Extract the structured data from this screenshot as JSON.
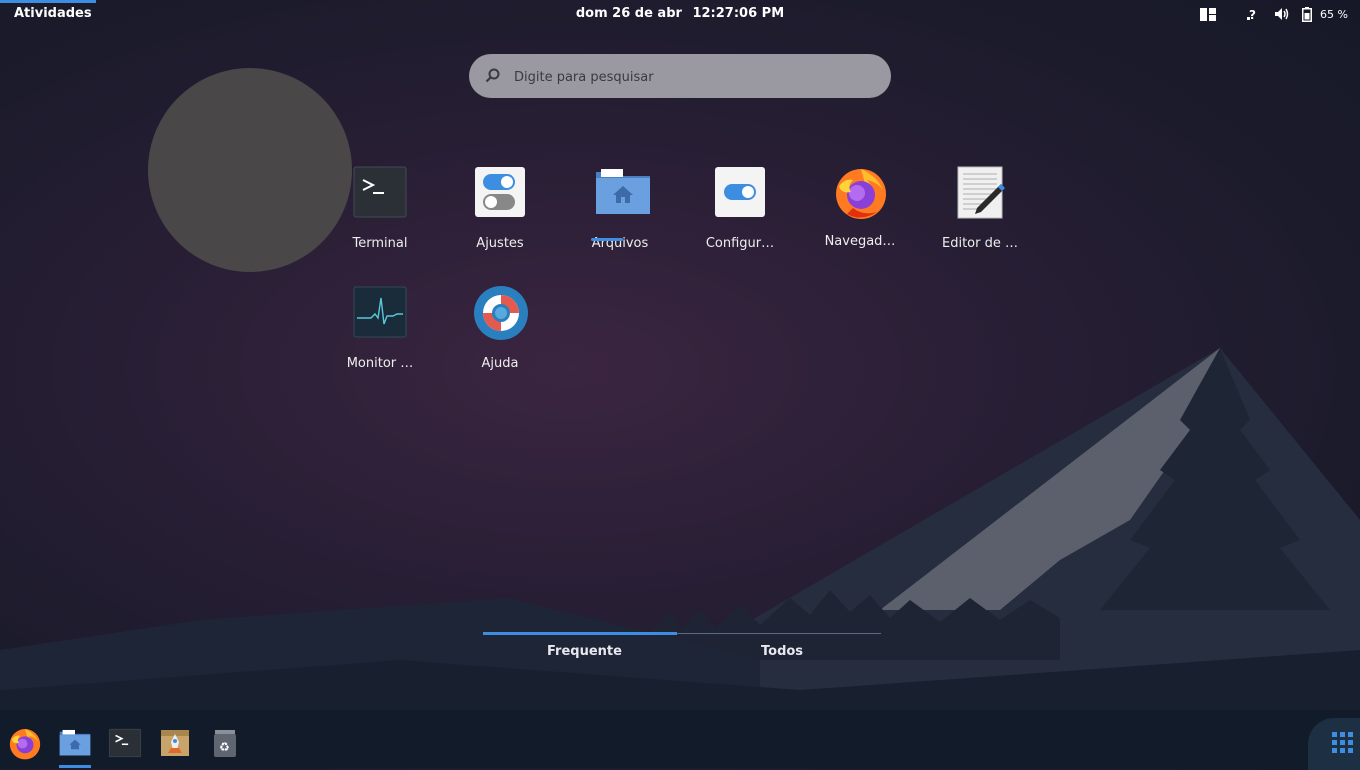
{
  "topbar": {
    "activities": "Atividades",
    "date": "dom 26 de abr",
    "time": "12:27:06 PM",
    "battery_percent": "65 %"
  },
  "search": {
    "placeholder": "Digite para pesquisar"
  },
  "apps": [
    {
      "label": "Terminal",
      "icon": "terminal-icon"
    },
    {
      "label": "Ajustes",
      "icon": "tweaks-icon"
    },
    {
      "label": "Arquivos",
      "icon": "files-folder-icon",
      "running": true
    },
    {
      "label": "Configur…",
      "icon": "settings-icon"
    },
    {
      "label": "Navegad…",
      "icon": "firefox-icon"
    },
    {
      "label": "Editor de …",
      "icon": "text-editor-icon"
    },
    {
      "label": "Monitor …",
      "icon": "system-monitor-icon"
    },
    {
      "label": "Ajuda",
      "icon": "help-lifebuoy-icon"
    }
  ],
  "tabs": {
    "frequent": "Frequente",
    "all": "Todos",
    "active": "Frequente"
  },
  "dock": [
    "firefox-icon",
    "files-folder-icon",
    "terminal-icon",
    "installer-icon",
    "trash-icon",
    "show-apps-grid-icon"
  ],
  "colors": {
    "accent": "#3d8ee0",
    "search_bg": "#9a98a0"
  }
}
